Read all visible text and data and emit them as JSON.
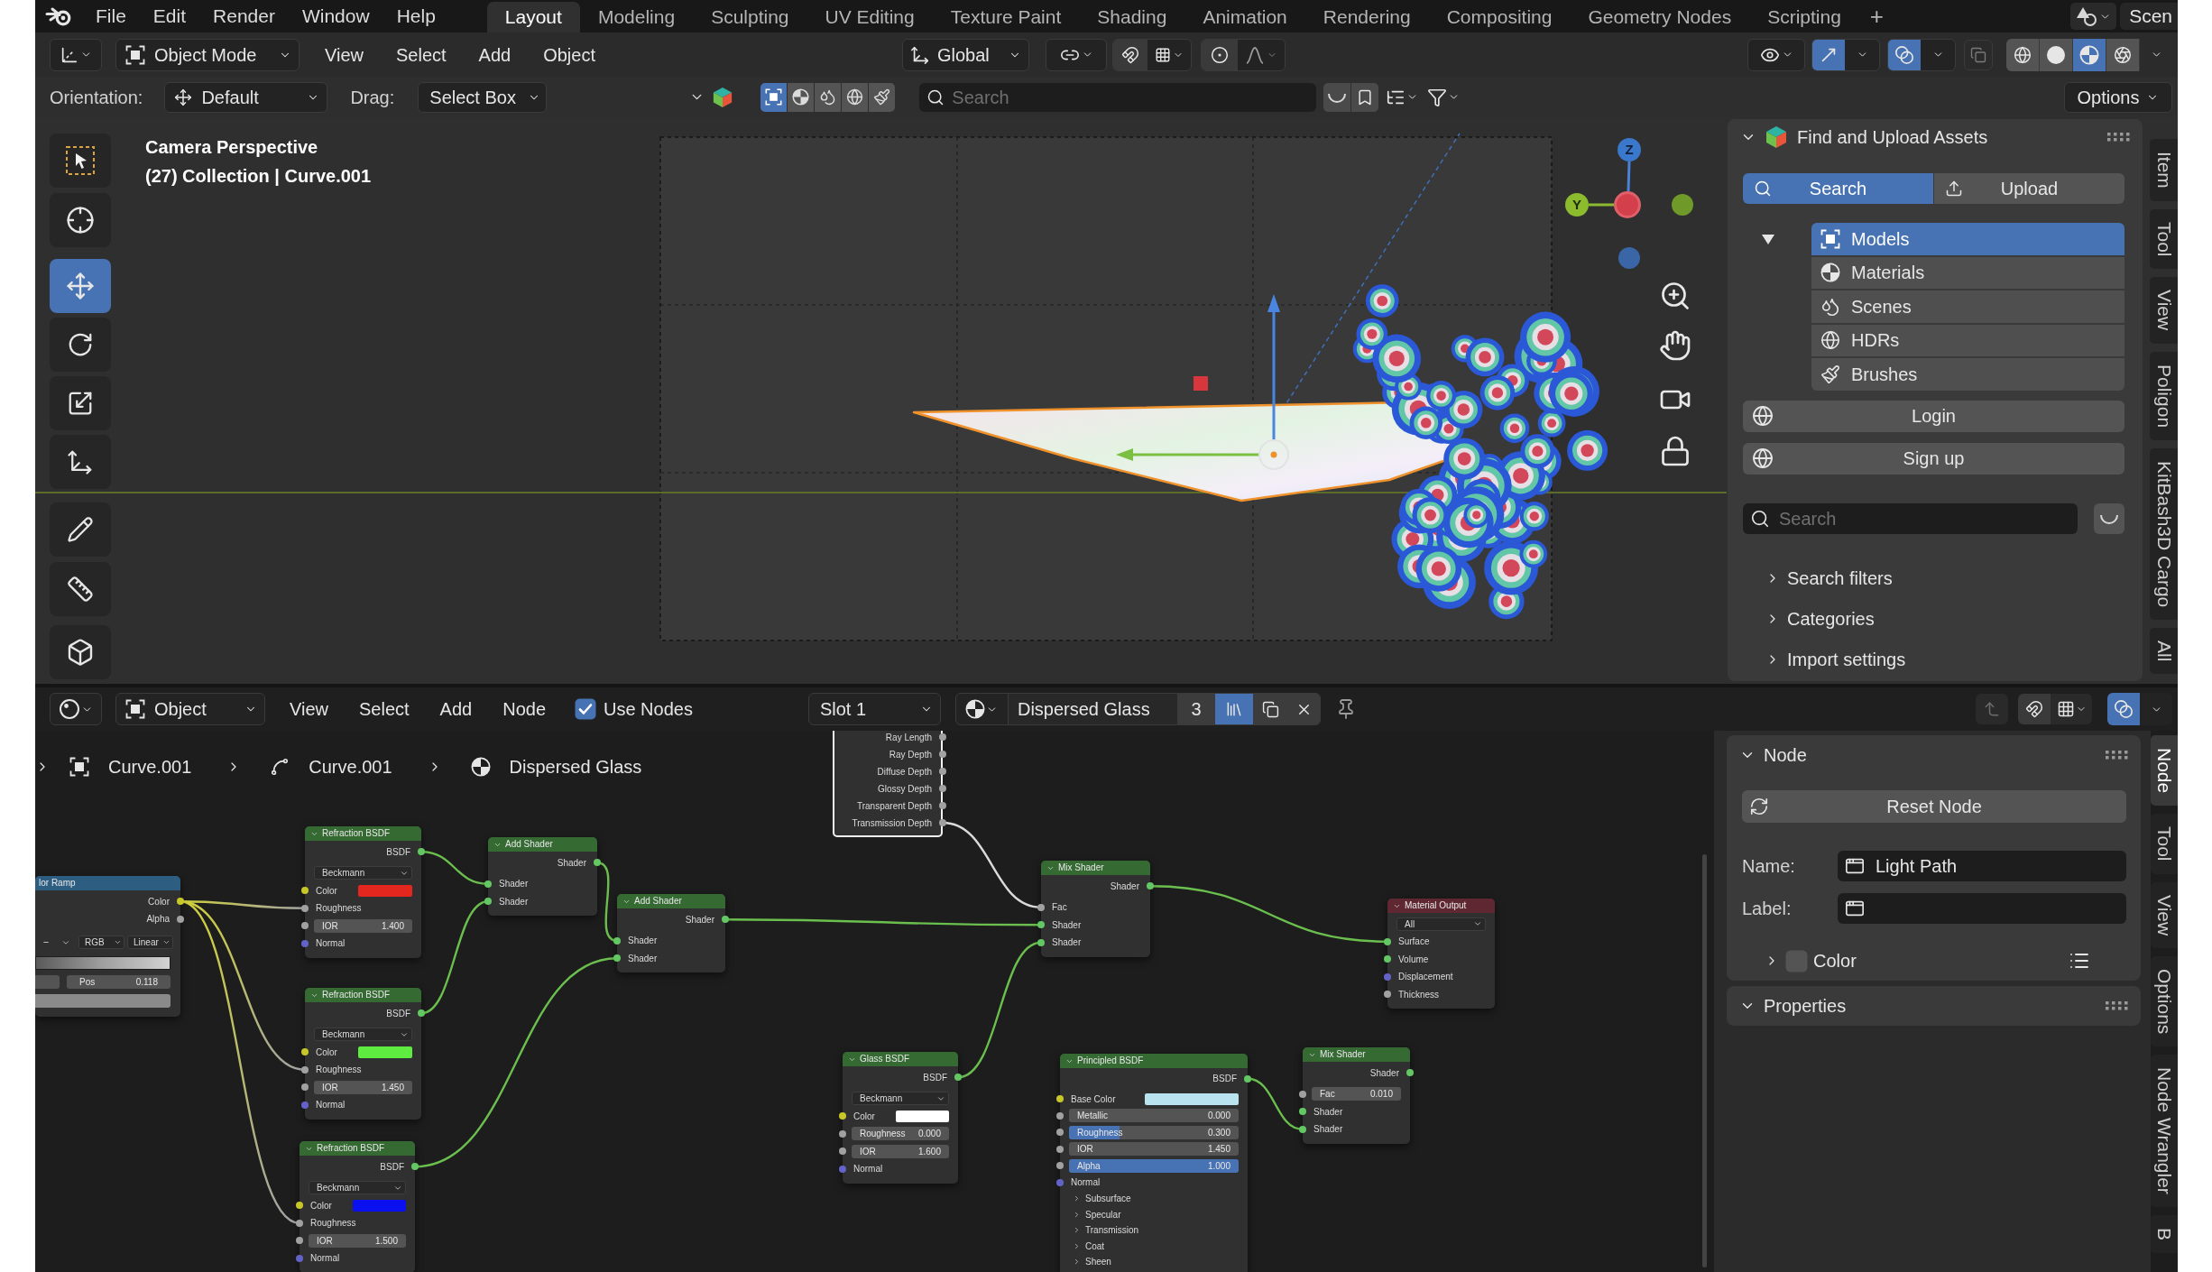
{
  "top_bar": {
    "menus": [
      "File",
      "Edit",
      "Render",
      "Window",
      "Help"
    ],
    "workspaces": [
      {
        "label": "Layout",
        "selected": true
      },
      {
        "label": "Modeling",
        "selected": false
      },
      {
        "label": "Sculpting",
        "selected": false
      },
      {
        "label": "UV Editing",
        "selected": false
      },
      {
        "label": "Texture Paint",
        "selected": false
      },
      {
        "label": "Shading",
        "selected": false
      },
      {
        "label": "Animation",
        "selected": false
      },
      {
        "label": "Rendering",
        "selected": false
      },
      {
        "label": "Compositing",
        "selected": false
      },
      {
        "label": "Geometry Nodes",
        "selected": false
      },
      {
        "label": "Scripting",
        "selected": false
      }
    ],
    "add_workspace": "+",
    "scene": "Scen"
  },
  "viewport": {
    "header": {
      "mode": "Object Mode",
      "menus": [
        "View",
        "Select",
        "Add",
        "Object"
      ],
      "transform_orientation": "Global",
      "snap_on": false,
      "proportional_editing_on": false,
      "gizmos_on": true,
      "overlays_on": true,
      "xray_on": false,
      "shading_modes": [
        {
          "selected": false
        },
        {
          "selected": false
        },
        {
          "selected": true
        },
        {
          "selected": false
        }
      ]
    },
    "tool_settings": {
      "orientation_label": "Orientation:",
      "orientation": "Default",
      "drag_label": "Drag:",
      "drag": "Select Box",
      "asset_types": [
        {
          "selected": true
        },
        {
          "selected": false
        },
        {
          "selected": false
        },
        {
          "selected": false
        },
        {
          "selected": false
        }
      ],
      "search": {
        "placeholder": "Search"
      },
      "options": "Options"
    },
    "tools": [
      {
        "selected": false
      },
      {
        "selected": false
      },
      {
        "selected": true
      },
      {
        "selected": false
      },
      {
        "selected": false
      },
      {
        "selected": false
      },
      {
        "selected": false
      },
      {
        "selected": false
      },
      {
        "selected": false
      }
    ],
    "overlay_text": [
      "Camera Perspective",
      "(27) Collection | Curve.001"
    ],
    "gizmo_labels": [
      "Z",
      "Y"
    ],
    "sidebar": {
      "panel": {
        "title": "Find and Upload Assets",
        "expanded": true,
        "modes": [
          {
            "label": "Search",
            "selected": true
          },
          {
            "label": "Upload",
            "selected": false
          }
        ],
        "asset_types_expanded": true,
        "asset_types": [
          {
            "label": "Models",
            "selected": true
          },
          {
            "label": "Materials",
            "selected": false
          },
          {
            "label": "Scenes",
            "selected": false
          },
          {
            "label": "HDRs",
            "selected": false
          },
          {
            "label": "Brushes",
            "selected": false
          }
        ],
        "buttons": [
          "Login",
          "Sign up"
        ],
        "search": {
          "placeholder": "Search"
        },
        "sections": [
          {
            "label": "Search filters",
            "expanded": false
          },
          {
            "label": "Categories",
            "expanded": false
          },
          {
            "label": "Import settings",
            "expanded": false
          }
        ]
      },
      "tabs": [
        "Item",
        "Tool",
        "View",
        "Poligon",
        "KitBash3D Cargo",
        "All"
      ]
    }
  },
  "node_editor": {
    "header": {
      "mode": "Object",
      "menus": [
        "View",
        "Select",
        "Add",
        "Node"
      ],
      "use_nodes": {
        "label": "Use Nodes",
        "checked": true
      },
      "slot": "Slot 1",
      "material": {
        "name": "Dispersed Glass",
        "users": "3",
        "fake_user": true
      },
      "overlays_on": true
    },
    "breadcrumbs": [
      "Curve.001",
      "Curve.001",
      "Dispersed Glass"
    ],
    "nodes": [
      {
        "title": "lor Ramp",
        "kind": "converter",
        "selected": false,
        "rows": [
          {
            "kind": "output",
            "label": "Color",
            "socket": {
              "kind": "color"
            }
          },
          {
            "kind": "output",
            "label": "Alpha",
            "socket": {
              "kind": "float"
            }
          },
          {
            "kind": "ramp_controls",
            "button": "−",
            "modes": [
              "RGB",
              "Linear"
            ]
          },
          {
            "kind": "ramp"
          },
          {
            "kind": "ramp_stop",
            "label": "Pos",
            "value": "0.118"
          },
          {
            "kind": "color_bar",
            "color": "#8a8a8a"
          }
        ]
      },
      {
        "title": "Refraction BSDF",
        "kind": "shader",
        "selected": false,
        "rows": [
          {
            "kind": "output",
            "label": "BSDF",
            "socket": {
              "kind": "shader"
            }
          },
          {
            "kind": "dropdown",
            "value": "Beckmann"
          },
          {
            "kind": "color",
            "label": "Color",
            "color": "#e3261e",
            "socket": {
              "kind": "color"
            }
          },
          {
            "kind": "input",
            "label": "Roughness",
            "socket": {
              "kind": "float"
            }
          },
          {
            "kind": "field",
            "label": "IOR",
            "value": "1.400",
            "socket": {
              "kind": "float"
            }
          },
          {
            "kind": "input",
            "label": "Normal",
            "socket": {
              "kind": "vector"
            }
          }
        ]
      },
      {
        "title": "Refraction BSDF",
        "kind": "shader",
        "selected": false,
        "rows": [
          {
            "kind": "output",
            "label": "BSDF",
            "socket": {
              "kind": "shader"
            }
          },
          {
            "kind": "dropdown",
            "value": "Beckmann"
          },
          {
            "kind": "color",
            "label": "Color",
            "color": "#5fec41",
            "socket": {
              "kind": "color"
            }
          },
          {
            "kind": "input",
            "label": "Roughness",
            "socket": {
              "kind": "float"
            }
          },
          {
            "kind": "field",
            "label": "IOR",
            "value": "1.450",
            "socket": {
              "kind": "float"
            }
          },
          {
            "kind": "input",
            "label": "Normal",
            "socket": {
              "kind": "vector"
            }
          }
        ]
      },
      {
        "title": "Refraction BSDF",
        "kind": "shader",
        "selected": false,
        "rows": [
          {
            "kind": "output",
            "label": "BSDF",
            "socket": {
              "kind": "shader"
            }
          },
          {
            "kind": "dropdown",
            "value": "Beckmann"
          },
          {
            "kind": "color",
            "label": "Color",
            "color": "#0a10f0",
            "socket": {
              "kind": "color"
            }
          },
          {
            "kind": "input",
            "label": "Roughness",
            "socket": {
              "kind": "float"
            }
          },
          {
            "kind": "field",
            "label": "IOR",
            "value": "1.500",
            "socket": {
              "kind": "float"
            }
          },
          {
            "kind": "input",
            "label": "Normal",
            "socket": {
              "kind": "vector"
            }
          }
        ]
      },
      {
        "title": "Add Shader",
        "kind": "shader",
        "selected": false,
        "rows": [
          {
            "kind": "output",
            "label": "Shader",
            "socket": {
              "kind": "shader"
            }
          },
          {
            "kind": "input",
            "label": "Shader",
            "socket": {
              "kind": "shader"
            }
          },
          {
            "kind": "input",
            "label": "Shader",
            "socket": {
              "kind": "shader"
            }
          }
        ]
      },
      {
        "title": "Add Shader",
        "kind": "shader",
        "selected": false,
        "rows": [
          {
            "kind": "output",
            "label": "Shader",
            "socket": {
              "kind": "shader"
            }
          },
          {
            "kind": "input",
            "label": "Shader",
            "socket": {
              "kind": "shader"
            }
          },
          {
            "kind": "input",
            "label": "Shader",
            "socket": {
              "kind": "shader"
            }
          }
        ]
      },
      {
        "selected": true,
        "rows": [
          {
            "kind": "output",
            "label": "Ray Length",
            "socket": {
              "kind": "float"
            }
          },
          {
            "kind": "output",
            "label": "Ray Depth",
            "socket": {
              "kind": "float"
            }
          },
          {
            "kind": "output",
            "label": "Diffuse Depth",
            "socket": {
              "kind": "float"
            }
          },
          {
            "kind": "output",
            "label": "Glossy Depth",
            "socket": {
              "kind": "float"
            }
          },
          {
            "kind": "output",
            "label": "Transparent Depth",
            "socket": {
              "kind": "float"
            }
          },
          {
            "kind": "output",
            "label": "Transmission Depth",
            "socket": {
              "kind": "float"
            }
          }
        ]
      },
      {
        "title": "Mix Shader",
        "kind": "shader",
        "selected": false,
        "rows": [
          {
            "kind": "output",
            "label": "Shader",
            "socket": {
              "kind": "shader"
            }
          },
          {
            "kind": "input",
            "label": "Fac",
            "socket": {
              "kind": "float"
            }
          },
          {
            "kind": "input",
            "label": "Shader",
            "socket": {
              "kind": "shader"
            }
          },
          {
            "kind": "input",
            "label": "Shader",
            "socket": {
              "kind": "shader"
            }
          }
        ]
      },
      {
        "title": "Material Output",
        "kind": "output",
        "selected": false,
        "rows": [
          {
            "kind": "dropdown",
            "value": "All"
          },
          {
            "kind": "input",
            "label": "Surface",
            "socket": {
              "kind": "shader"
            }
          },
          {
            "kind": "input",
            "label": "Volume",
            "socket": {
              "kind": "shader"
            }
          },
          {
            "kind": "input",
            "label": "Displacement",
            "socket": {
              "kind": "vector"
            }
          },
          {
            "kind": "input",
            "label": "Thickness",
            "socket": {
              "kind": "float"
            }
          }
        ]
      },
      {
        "title": "Glass BSDF",
        "kind": "shader",
        "selected": false,
        "rows": [
          {
            "kind": "output",
            "label": "BSDF",
            "socket": {
              "kind": "shader"
            }
          },
          {
            "kind": "dropdown",
            "value": "Beckmann"
          },
          {
            "kind": "color",
            "label": "Color",
            "color": "#ffffff",
            "socket": {
              "kind": "color"
            }
          },
          {
            "kind": "field",
            "label": "Roughness",
            "value": "0.000",
            "socket": {
              "kind": "float"
            }
          },
          {
            "kind": "field",
            "label": "IOR",
            "value": "1.600",
            "socket": {
              "kind": "float"
            }
          },
          {
            "kind": "input",
            "label": "Normal",
            "socket": {
              "kind": "vector"
            }
          }
        ]
      },
      {
        "title": "Principled BSDF",
        "kind": "shader",
        "selected": false,
        "rows": [
          {
            "kind": "output",
            "label": "BSDF",
            "socket": {
              "kind": "shader"
            }
          },
          {
            "kind": "color",
            "label": "Base Color",
            "color": "#b9e3ef",
            "socket": {
              "kind": "color"
            }
          },
          {
            "kind": "field",
            "label": "Metallic",
            "value": "0.000",
            "socket": {
              "kind": "float"
            }
          },
          {
            "kind": "field",
            "label": "Roughness",
            "value": "0.300",
            "socket": {
              "kind": "float"
            },
            "level": 0.3
          },
          {
            "kind": "field",
            "label": "IOR",
            "value": "1.450",
            "socket": {
              "kind": "float"
            }
          },
          {
            "kind": "field",
            "label": "Alpha",
            "value": "1.000",
            "socket": {
              "kind": "float"
            },
            "level": 1
          },
          {
            "kind": "input",
            "label": "Normal",
            "socket": {
              "kind": "vector"
            }
          },
          {
            "kind": "panel",
            "label": "Subsurface"
          },
          {
            "kind": "panel",
            "label": "Specular"
          },
          {
            "kind": "panel",
            "label": "Transmission"
          },
          {
            "kind": "panel",
            "label": "Coat"
          },
          {
            "kind": "panel",
            "label": "Sheen"
          }
        ]
      },
      {
        "title": "Mix Shader",
        "kind": "shader",
        "selected": false,
        "rows": [
          {
            "kind": "output",
            "label": "Shader",
            "socket": {
              "kind": "shader"
            }
          },
          {
            "kind": "field",
            "label": "Fac",
            "value": "0.010",
            "socket": {
              "kind": "float"
            }
          },
          {
            "kind": "input",
            "label": "Shader",
            "socket": {
              "kind": "shader"
            }
          },
          {
            "kind": "input",
            "label": "Shader",
            "socket": {
              "kind": "shader"
            }
          }
        ]
      }
    ],
    "sidebar": {
      "node_panel": {
        "title": "Node",
        "expanded": true,
        "reset_button": "Reset Node",
        "name_label": "Name:",
        "name": "Light Path",
        "label_label": "Label:",
        "color": {
          "label": "Color",
          "expanded": false,
          "checked": false
        }
      },
      "properties_panel": {
        "title": "Properties",
        "expanded": true
      },
      "tabs": [
        {
          "label": "Node",
          "selected": true
        },
        {
          "label": "Tool",
          "selected": false
        },
        {
          "label": "View",
          "selected": false
        },
        {
          "label": "Options",
          "selected": false
        },
        {
          "label": "Node Wrangler",
          "selected": false
        },
        {
          "label": "B",
          "selected": false
        }
      ]
    }
  }
}
